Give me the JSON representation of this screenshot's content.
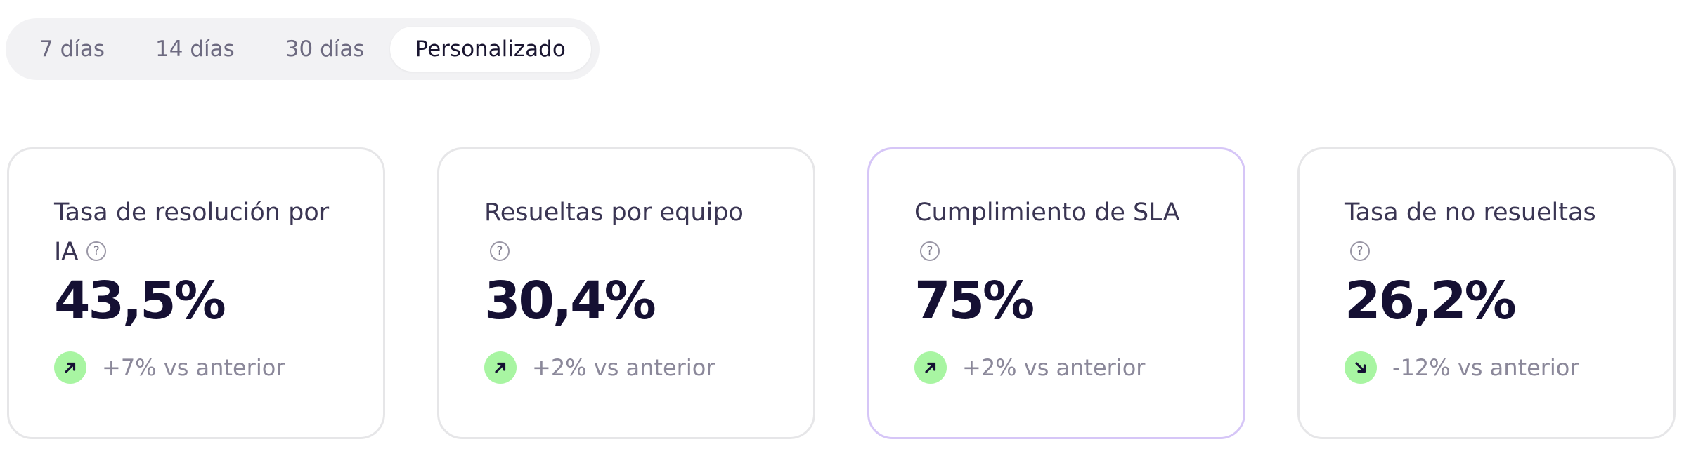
{
  "period_selector": {
    "options": [
      {
        "label": "7 días",
        "selected": false
      },
      {
        "label": "14 días",
        "selected": false
      },
      {
        "label": "30 días",
        "selected": false
      },
      {
        "label": "Personalizado",
        "selected": true
      }
    ]
  },
  "help_glyph": "?",
  "metrics": [
    {
      "title": "Tasa de resolución por IA",
      "value": "43,5%",
      "trend": {
        "direction": "up",
        "icon": "arrow-up-right-icon",
        "text": "+7% vs anterior"
      }
    },
    {
      "title": "Resueltas por equipo",
      "value": "30,4%",
      "trend": {
        "direction": "up",
        "icon": "arrow-up-right-icon",
        "text": "+2% vs anterior"
      }
    },
    {
      "title": "Cumplimiento de SLA",
      "value": "75%",
      "trend": {
        "direction": "up",
        "icon": "arrow-up-right-icon",
        "text": "+2% vs anterior"
      }
    },
    {
      "title": "Tasa de no resueltas",
      "value": "26,2%",
      "trend": {
        "direction": "down",
        "icon": "arrow-down-right-icon",
        "text": "-12% vs anterior"
      }
    }
  ],
  "colors": {
    "trend_badge_bg": "#a8f5a2",
    "highlight_border": "#d6c6f7",
    "card_border": "#e6e6e8",
    "value_text": "#151033"
  }
}
